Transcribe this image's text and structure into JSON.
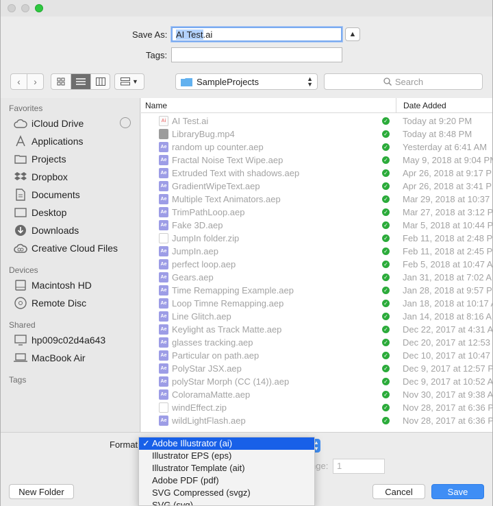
{
  "save_as": {
    "label": "Save As:",
    "filename_selected": "AI Test",
    "filename_rest": ".ai",
    "tags_label": "Tags:",
    "tags_value": ""
  },
  "toolbar": {
    "back_icon": "chevron-left",
    "forward_icon": "chevron-right",
    "location": "SampleProjects",
    "search_placeholder": "Search"
  },
  "sidebar": {
    "favorites_heading": "Favorites",
    "favorites": [
      {
        "label": "iCloud Drive",
        "icon": "cloud-icon"
      },
      {
        "label": "Applications",
        "icon": "applications-icon"
      },
      {
        "label": "Projects",
        "icon": "folder-icon"
      },
      {
        "label": "Dropbox",
        "icon": "dropbox-icon"
      },
      {
        "label": "Documents",
        "icon": "documents-icon"
      },
      {
        "label": "Desktop",
        "icon": "desktop-icon"
      },
      {
        "label": "Downloads",
        "icon": "downloads-icon"
      },
      {
        "label": "Creative Cloud Files",
        "icon": "creative-cloud-icon"
      }
    ],
    "devices_heading": "Devices",
    "devices": [
      {
        "label": "Macintosh HD",
        "icon": "harddrive-icon"
      },
      {
        "label": "Remote Disc",
        "icon": "disc-icon"
      }
    ],
    "shared_heading": "Shared",
    "shared": [
      {
        "label": "hp009c02d4a643",
        "icon": "monitor-icon"
      },
      {
        "label": "MacBook Air",
        "icon": "laptop-icon"
      }
    ],
    "tags_heading": "Tags"
  },
  "file_list": {
    "col_name": "Name",
    "col_date": "Date Added",
    "rows": [
      {
        "name": "AI Test.ai",
        "date": "Today at 9:20 PM",
        "type": "ai"
      },
      {
        "name": "LibraryBug.mp4",
        "date": "Today at 8:48 PM",
        "type": "mp4"
      },
      {
        "name": "random up counter.aep",
        "date": "Yesterday at 6:41 AM",
        "type": "ae"
      },
      {
        "name": "Fractal Noise Text Wipe.aep",
        "date": "May 9, 2018 at 9:04 PM",
        "type": "ae"
      },
      {
        "name": "Extruded Text with shadows.aep",
        "date": "Apr 26, 2018 at 9:17 PM",
        "type": "ae"
      },
      {
        "name": "GradientWipeText.aep",
        "date": "Apr 26, 2018 at 3:41 PM",
        "type": "ae"
      },
      {
        "name": "Multiple Text Animators.aep",
        "date": "Mar 29, 2018 at 10:37",
        "type": "ae"
      },
      {
        "name": "TrimPathLoop.aep",
        "date": "Mar 27, 2018 at 3:12 PM",
        "type": "ae"
      },
      {
        "name": "Fake 3D.aep",
        "date": "Mar 5, 2018 at 10:44 PM",
        "type": "ae"
      },
      {
        "name": "JumpIn folder.zip",
        "date": "Feb 11, 2018 at 2:48 PM",
        "type": "zip"
      },
      {
        "name": "JumpIn.aep",
        "date": "Feb 11, 2018 at 2:45 PM",
        "type": "ae"
      },
      {
        "name": "perfect loop.aep",
        "date": "Feb 5, 2018 at 10:47 AM",
        "type": "ae"
      },
      {
        "name": "Gears.aep",
        "date": "Jan 31, 2018 at 7:02 AM",
        "type": "ae"
      },
      {
        "name": "Time Remapping Example.aep",
        "date": "Jan 28, 2018 at 9:57 PM",
        "type": "ae"
      },
      {
        "name": "Loop Timne Remapping.aep",
        "date": "Jan 18, 2018 at 10:17 A",
        "type": "ae"
      },
      {
        "name": "Line Glitch.aep",
        "date": "Jan 14, 2018 at 8:16 AM",
        "type": "ae"
      },
      {
        "name": "Keylight as Track Matte.aep",
        "date": "Dec 22, 2017 at 4:31 AM",
        "type": "ae"
      },
      {
        "name": "glasses tracking.aep",
        "date": "Dec 20, 2017 at 12:53",
        "type": "ae"
      },
      {
        "name": "Particular on path.aep",
        "date": "Dec 10, 2017 at 10:47 P",
        "type": "ae"
      },
      {
        "name": "PolyStar JSX.aep",
        "date": "Dec 9, 2017 at 12:57 PM",
        "type": "ae"
      },
      {
        "name": "polyStar Morph (CC (14)).aep",
        "date": "Dec 9, 2017 at 10:52 A",
        "type": "ae"
      },
      {
        "name": "ColoramaMatte.aep",
        "date": "Nov 30, 2017 at 9:38 A",
        "type": "ae"
      },
      {
        "name": "windEffect.zip",
        "date": "Nov 28, 2017 at 6:36 P",
        "type": "zip"
      },
      {
        "name": "wildLightFlash.aep",
        "date": "Nov 28, 2017 at 6:36 P",
        "type": "ae"
      }
    ]
  },
  "format": {
    "label": "Format",
    "range_label": "nge:",
    "range_value": "1",
    "options": [
      {
        "label": "Adobe Illustrator (ai)",
        "selected": true
      },
      {
        "label": "Illustrator EPS (eps)",
        "selected": false
      },
      {
        "label": "Illustrator Template (ait)",
        "selected": false
      },
      {
        "label": "Adobe PDF (pdf)",
        "selected": false
      },
      {
        "label": "SVG Compressed (svgz)",
        "selected": false
      },
      {
        "label": "SVG (svg)",
        "selected": false
      }
    ]
  },
  "buttons": {
    "new_folder": "New Folder",
    "cancel": "Cancel",
    "save": "Save"
  }
}
